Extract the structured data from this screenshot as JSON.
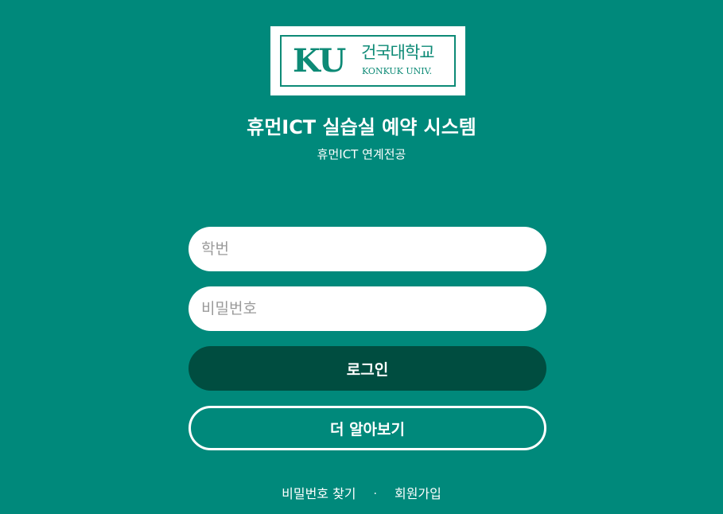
{
  "logo": {
    "abbr": "KU",
    "korean": "건국대학교",
    "english": "KONKUK UNIV."
  },
  "header": {
    "title": "휴먼ICT 실습실 예약 시스템",
    "subtitle": "휴먼ICT 연계전공"
  },
  "form": {
    "student_id_placeholder": "학번",
    "password_placeholder": "비밀번호",
    "login_label": "로그인",
    "more_label": "더 알아보기"
  },
  "links": {
    "find_password": "비밀번호 찾기",
    "separator": "·",
    "signup": "회원가입"
  }
}
